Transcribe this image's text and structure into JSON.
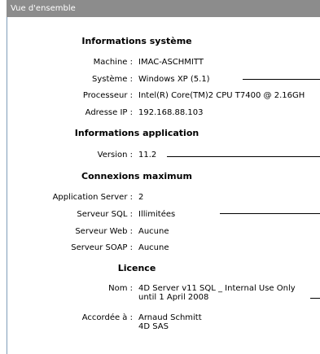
{
  "window": {
    "title": "Vue d'ensemble"
  },
  "sections": {
    "system": {
      "title": "Informations système",
      "rows": [
        {
          "label": "Machine :",
          "value": "IMAC-ASCHMITT"
        },
        {
          "label": "Système :",
          "value": "Windows XP (5.1)"
        },
        {
          "label": "Processeur :",
          "value": "Intel(R) Core(TM)2 CPU T7400 @ 2.16GH"
        },
        {
          "label": "Adresse IP :",
          "value": "192.168.88.103"
        }
      ]
    },
    "application": {
      "title": "Informations application",
      "rows": [
        {
          "label": "Version :",
          "value": "11.2"
        }
      ]
    },
    "connections": {
      "title": "Connexions maximum",
      "rows": [
        {
          "label": "Application Server :",
          "value": "2"
        },
        {
          "label": "Serveur SQL :",
          "value": "Illimitées"
        },
        {
          "label": "Serveur Web :",
          "value": "Aucune"
        },
        {
          "label": "Serveur SOAP :",
          "value": "Aucune"
        }
      ]
    },
    "license": {
      "title": "Licence",
      "rows": [
        {
          "label": "Nom :",
          "value_line1": "4D Server v11 SQL _ Internal Use Only",
          "value_line2": "until 1 April 2008"
        },
        {
          "label": "Accordée à :",
          "value_line1": "Arnaud Schmitt",
          "value_line2": "4D SAS"
        }
      ]
    }
  }
}
